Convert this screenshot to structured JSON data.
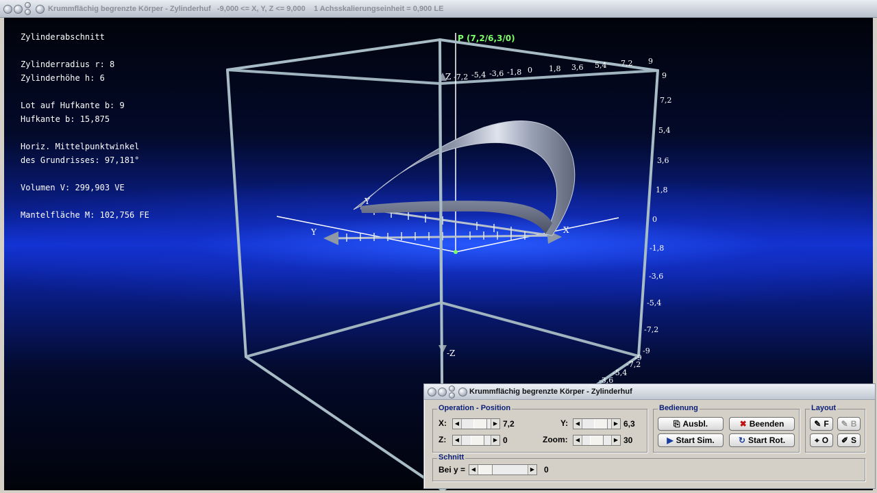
{
  "window": {
    "title": "Krummflächig begrenzte Körper - Zylinderhuf   -9,000 <= X, Y, Z <= 9,000    1 Achsskalierungseinheit = 0,900 LE"
  },
  "info": {
    "heading": "Zylinderabschnitt",
    "radius": "Zylinderradius r: 8",
    "height": "Zylinderhöhe h: 6",
    "lot": "Lot auf Hufkante b: 9",
    "hufkante": "Hufkante b: 15,875",
    "angle1": "Horiz. Mittelpunktwinkel",
    "angle2": "des Grundrisses: 97,181°",
    "volume": "Volumen V: 299,903 VE",
    "surface": "Mantelfläche M: 102,756 FE"
  },
  "scene": {
    "point_label": "P (7,2/6,3/0)",
    "axis_x": "X",
    "axis_y": "Y",
    "axis_z": "Z",
    "axis_negz": "-Z",
    "top_ticks": [
      "-7,2",
      "-5,4",
      "-3,6",
      "-1,8",
      "0",
      "1,8",
      "3,6",
      "5,4",
      "7,2",
      "9"
    ],
    "right_ticks": [
      "9",
      "7,2",
      "5,4",
      "3,6",
      "1,8",
      "0",
      "-1,8",
      "-3,6",
      "-5,4",
      "-7,2",
      "-9"
    ],
    "bottom_ticks": [
      "-9",
      "-7,2",
      "-5,4",
      "-3,6"
    ],
    "colors": {
      "surface": "#9aa3b8",
      "frame": "#a8bcc6",
      "point": "#7dff6a"
    }
  },
  "control": {
    "title": "Krummflächig begrenzte Körper - Zylinderhuf",
    "operation": {
      "legend": "Operation - Position",
      "x_label": "X:",
      "x_value": "7,2",
      "y_label": "Y:",
      "y_value": "6,3",
      "z_label": "Z:",
      "z_value": "0",
      "zoom_label": "Zoom:",
      "zoom_value": "30"
    },
    "bedienung": {
      "legend": "Bedienung",
      "ausbl": "Ausbl.",
      "beenden": "Beenden",
      "start_sim": "Start Sim.",
      "start_rot": "Start Rot."
    },
    "layout": {
      "legend": "Layout",
      "f": "F",
      "b": "B",
      "o": "O",
      "s": "S"
    },
    "schnitt": {
      "legend": "Schnitt",
      "label": "Bei y =",
      "value": "0"
    }
  }
}
